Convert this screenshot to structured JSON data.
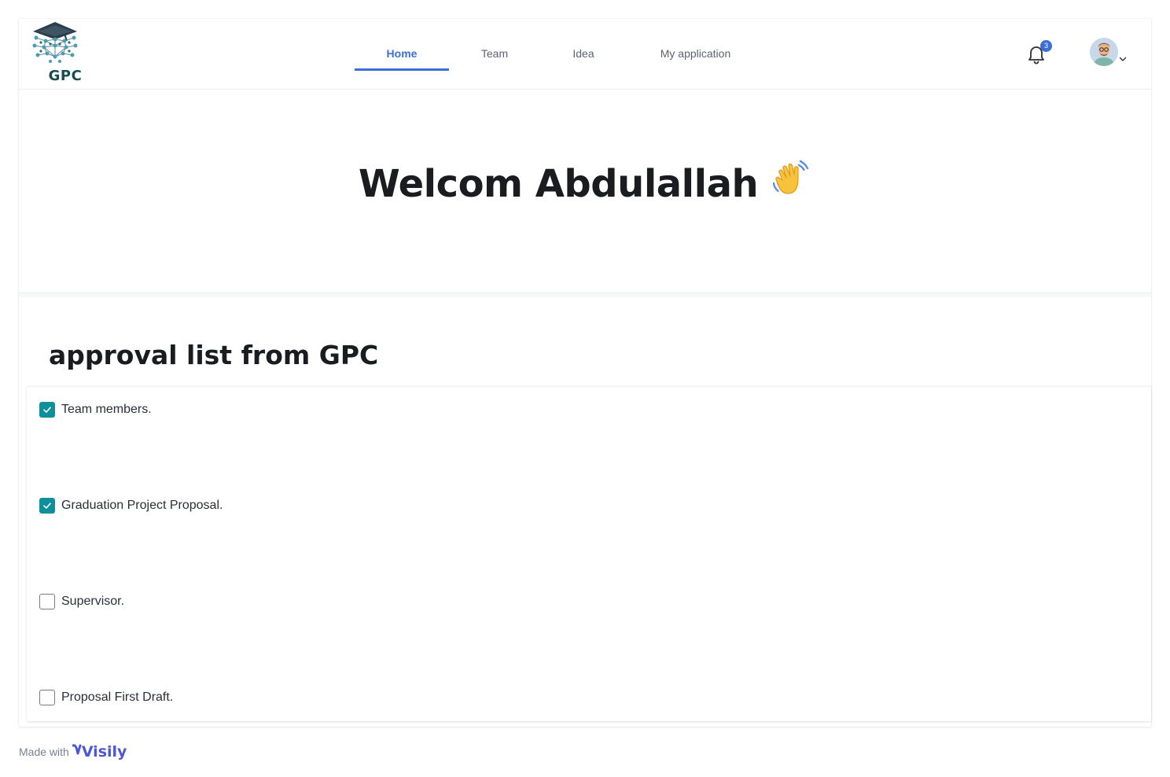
{
  "brand": {
    "logo_text": "GPC"
  },
  "nav": {
    "tabs": [
      {
        "label": "Home",
        "active": true
      },
      {
        "label": "Team",
        "active": false
      },
      {
        "label": "Idea",
        "active": false
      },
      {
        "label": "My application",
        "active": false
      }
    ]
  },
  "notifications": {
    "count": "3",
    "icon": "bell-icon"
  },
  "user": {
    "avatar": "user-avatar",
    "menu_icon": "chevron-down-icon"
  },
  "welcome": {
    "title": "Welcom Abdulallah",
    "emoji": "waving-hand-icon"
  },
  "approvals": {
    "title": "approval list from GPC",
    "items": [
      {
        "label": "Team members.",
        "checked": true
      },
      {
        "label": "Graduation Project Proposal.",
        "checked": true
      },
      {
        "label": "Supervisor.",
        "checked": false
      },
      {
        "label": "Proposal First Draft.",
        "checked": false
      }
    ]
  },
  "footer": {
    "made_with": "Made with",
    "brand": "Visily"
  },
  "colors": {
    "accent": "#3b6fd6",
    "checkbox_checked": "#0e8f9c",
    "visily": "#4d56d8"
  }
}
